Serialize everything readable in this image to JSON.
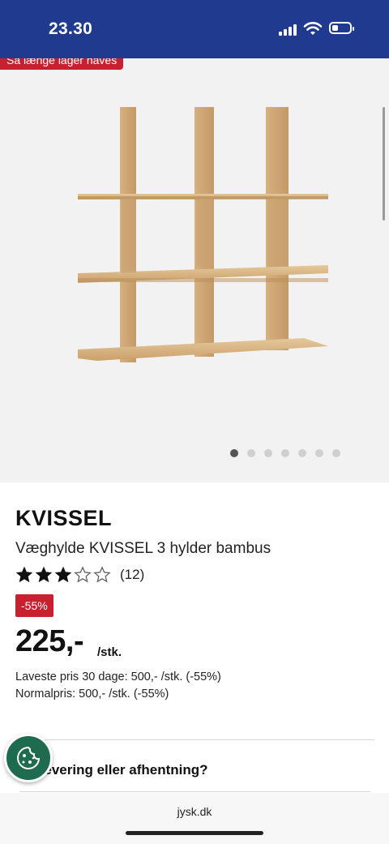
{
  "status_bar": {
    "time": "23.30"
  },
  "gallery": {
    "promo_tag": "Så længe lager haves",
    "image_alt": "Væghylde KVISSEL 3 hylder bambus",
    "dot_count": 7,
    "active_index": 0
  },
  "product": {
    "name": "KVISSEL",
    "description": "Væghylde KVISSEL 3 hylder bambus",
    "rating": {
      "value": 3,
      "max": 5,
      "count_label": "(12)"
    },
    "discount_badge": "-55%",
    "price": "225,-",
    "unit": "/stk.",
    "lowest_price_note": "Laveste pris 30 dage: 500,- /stk. (-55%)",
    "normal_price_note": "Normalpris: 500,- /stk. (-55%)"
  },
  "delivery": {
    "label": "Levering eller afhentning?"
  },
  "browser": {
    "url": "jysk.dk"
  },
  "colors": {
    "brand_blue": "#1f3a8f",
    "sale_red": "#c8202f",
    "cookie_green": "#1e6b4f"
  }
}
